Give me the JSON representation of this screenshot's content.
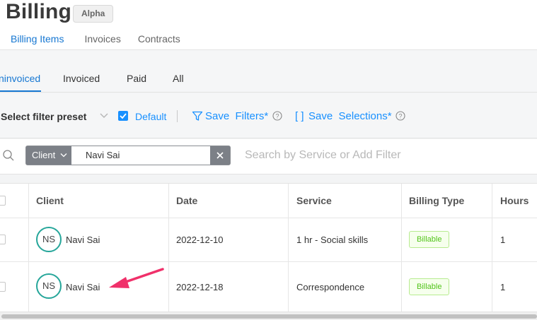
{
  "header": {
    "title": "Billing",
    "badge": "Alpha"
  },
  "subtabs": [
    "Billing Items",
    "Invoices",
    "Contracts"
  ],
  "status_tabs": [
    "ninvoiced",
    "Invoiced",
    "Paid",
    "All"
  ],
  "filter_bar": {
    "preset_label": "Select filter preset",
    "default_label": "Default",
    "default_checked": true,
    "save_filters_label": "Save  Filters*",
    "bracket_icon": "[ ]",
    "save_selections_label": "Save  Selections*"
  },
  "search": {
    "chip_field": "Client",
    "chip_value": "Navi Sai",
    "placeholder": "Search by Service or Add Filter"
  },
  "table": {
    "columns": [
      "Client",
      "Date",
      "Service",
      "Billing Type",
      "Hours"
    ],
    "rows": [
      {
        "initials": "NS",
        "client": "Navi Sai",
        "date": "2022-12-10",
        "service": "1 hr - Social skills",
        "billing_type": "Billable",
        "hours": "1"
      },
      {
        "initials": "NS",
        "client": "Navi Sai",
        "date": "2022-12-18",
        "service": "Correspondence",
        "billing_type": "Billable",
        "hours": "1"
      }
    ]
  },
  "colors": {
    "accent": "#1677d2",
    "avatar_ring": "#26a69a",
    "arrow": "#f0306a",
    "billable_text": "#52c41a"
  }
}
